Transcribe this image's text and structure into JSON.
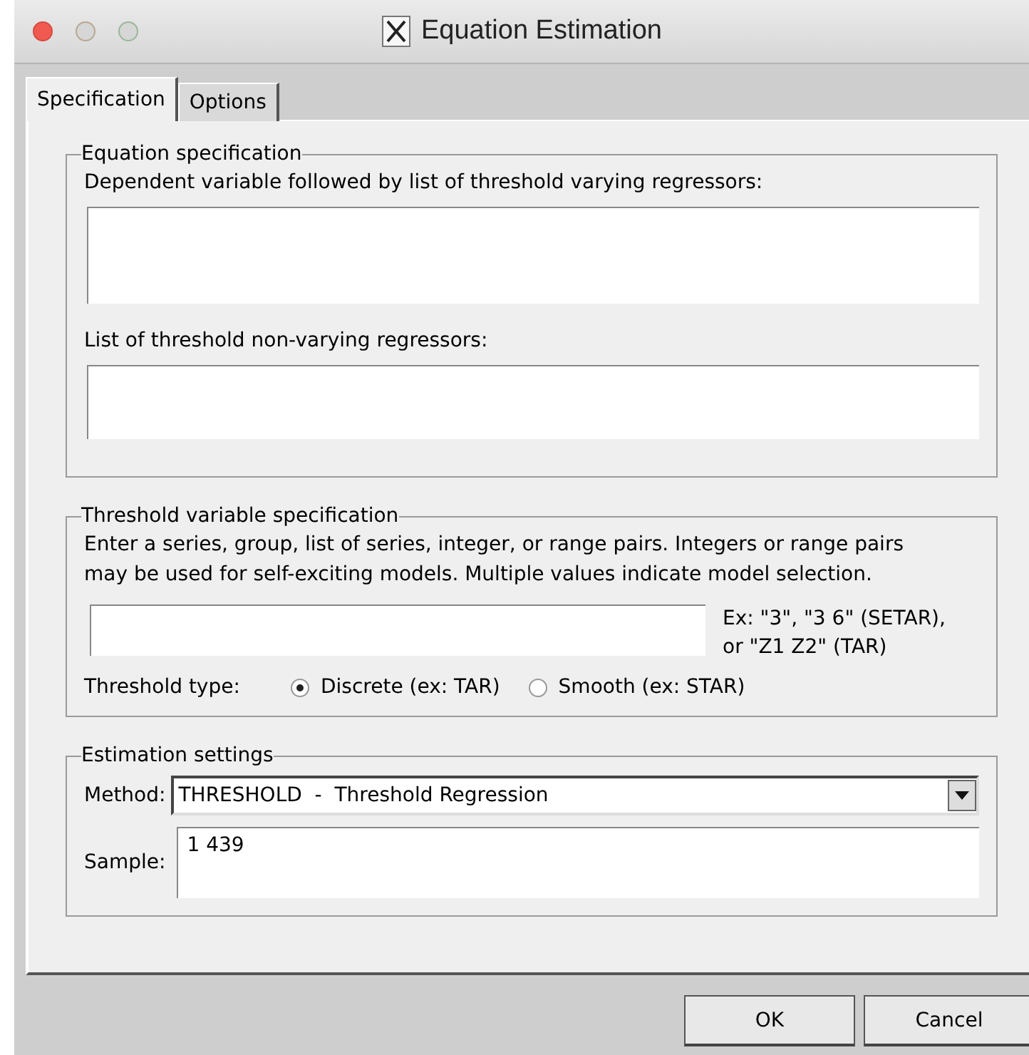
{
  "window": {
    "title": "Equation Estimation"
  },
  "tabs": [
    {
      "label": "Specification",
      "selected": true
    },
    {
      "label": "Options",
      "selected": false
    }
  ],
  "equation_specification": {
    "title": "Equation specification",
    "fields": [
      {
        "label": "Dependent variable followed by list of threshold varying regressors:"
      },
      {
        "label": "List of threshold non-varying regressors:"
      }
    ]
  },
  "threshold_variable": {
    "title": "Threshold variable specification",
    "description": "Enter a series, group, list of series, integer, or range pairs. Integers or range pairs\nmay be used for self-exciting models. Multiple values indicate model selection.",
    "example": "Ex: \"3\", \"3 6\" (SETAR),\nor \"Z1 Z2\" (TAR)",
    "type_label": "Threshold type:",
    "options": [
      {
        "label": "Discrete (ex: TAR)",
        "selected": true
      },
      {
        "label": "Smooth (ex: STAR)",
        "selected": false
      }
    ]
  },
  "estimation_settings": {
    "title": "Estimation settings",
    "method_label": "Method:",
    "method": "THRESHOLD  -  Threshold Regression",
    "sample_label": "Sample:",
    "sample": "1 439"
  },
  "buttons": [
    "OK",
    "Cancel"
  ]
}
